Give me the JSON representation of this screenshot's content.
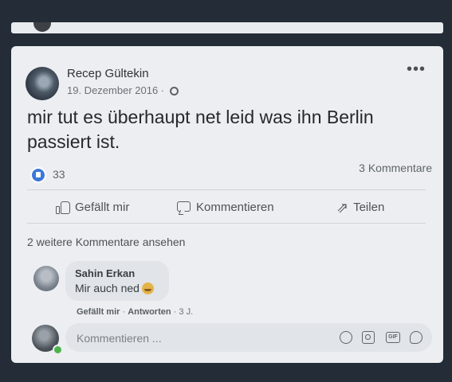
{
  "post": {
    "author": "Recep Gültekin",
    "date": "19. Dezember 2016 ·",
    "text": "mir tut es überhaupt net leid was ihn Berlin passiert ist.",
    "reaction_count": "33",
    "comment_count": "3 Kommentare",
    "more_icon": "more-horizontal-icon",
    "privacy_icon": "globe-icon"
  },
  "actions": {
    "like": "Gefällt mir",
    "comment": "Kommentieren",
    "share": "Teilen"
  },
  "comments": {
    "view_more": "2 weitere Kommentare ansehen",
    "items": [
      {
        "name": "Sahin Erkan",
        "text": "Mir auch ned",
        "like": "Gefällt mir",
        "reply": "Antworten",
        "time": "3 J."
      }
    ]
  },
  "composer": {
    "placeholder": "Kommentieren ..."
  },
  "colors": {
    "card_bg": "#eceef1",
    "like_blue": "#3b78d8"
  }
}
